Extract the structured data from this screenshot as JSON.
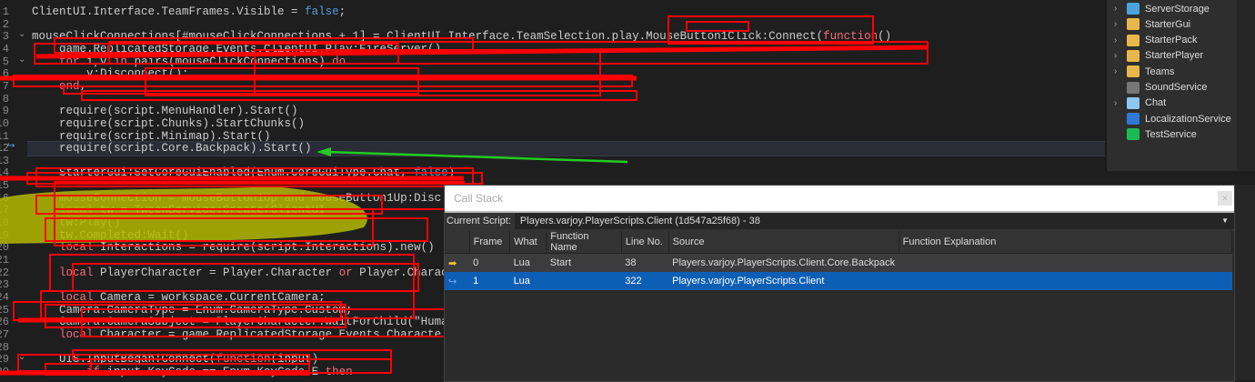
{
  "editor": {
    "lines": [
      {
        "n": "1",
        "segs": [
          [
            "ClientUI.Interface.TeamFrames.Visible = ",
            ""
          ],
          [
            "false",
            "bool"
          ],
          [
            ";",
            ""
          ]
        ]
      },
      {
        "n": "2",
        "segs": []
      },
      {
        "n": "3",
        "fold": true,
        "segs": [
          [
            "mouseClickConnections[#mouseClickConnections + 1] = ClientUI.Interface.TeamSelection.play.MouseButton1Click:Connect(",
            ""
          ],
          [
            "function",
            "kw"
          ],
          [
            "()",
            ""
          ]
        ]
      },
      {
        "n": "4",
        "segs": [
          [
            "    game.ReplicatedStorage.Events.ClientUI.Play:FireServer()",
            ""
          ]
        ]
      },
      {
        "n": "5",
        "fold": true,
        "segs": [
          [
            "    ",
            ""
          ],
          [
            "for",
            "kw"
          ],
          [
            " i,v ",
            ""
          ],
          [
            "in",
            "kw"
          ],
          [
            " pairs(mouseClickConnections) ",
            ""
          ],
          [
            "do",
            "kw"
          ]
        ]
      },
      {
        "n": "6",
        "segs": [
          [
            "        v:Disconnect();",
            ""
          ]
        ]
      },
      {
        "n": "7",
        "segs": [
          [
            "    ",
            ""
          ],
          [
            "end",
            "kw"
          ],
          [
            ",",
            ""
          ]
        ]
      },
      {
        "n": "8",
        "segs": []
      },
      {
        "n": "9",
        "segs": [
          [
            "    require(script.MenuHandler).Start()",
            ""
          ]
        ]
      },
      {
        "n": "10",
        "segs": [
          [
            "    require(script.Chunks).StartChunks()",
            ""
          ]
        ]
      },
      {
        "n": "11",
        "segs": [
          [
            "    require(script.Minimap).Start()",
            ""
          ]
        ]
      },
      {
        "n": "12",
        "current": true,
        "segs": [
          [
            "    require(script.Core.Backpack).Start()",
            ""
          ]
        ]
      },
      {
        "n": "13",
        "segs": []
      },
      {
        "n": "14",
        "segs": [
          [
            "    StarterGui:SetCoreGuiEnabled(Enum.CoreGuiType.Chat, ",
            ""
          ],
          [
            "false",
            "bool"
          ],
          [
            ")",
            ""
          ]
        ]
      },
      {
        "n": "15",
        "segs": []
      },
      {
        "n": "16",
        "segs": [
          [
            "    mouseConnection = mouseButton1Up and mouseButton1Up:Disc",
            ""
          ]
        ]
      },
      {
        "n": "17",
        "segs": [
          [
            "    ",
            ""
          ],
          [
            "local",
            "kw"
          ],
          [
            " tw = TweenService:Create(ClientUI",
            ""
          ]
        ]
      },
      {
        "n": "18",
        "segs": [
          [
            "    tw:Play()",
            ""
          ]
        ]
      },
      {
        "n": "19",
        "segs": [
          [
            "    tw.Completed:Wait()",
            ""
          ]
        ]
      },
      {
        "n": "20",
        "segs": [
          [
            "    ",
            ""
          ],
          [
            "local",
            "kw"
          ],
          [
            " Interactions = require(script.Interactions).new()",
            ""
          ]
        ]
      },
      {
        "n": "21",
        "segs": []
      },
      {
        "n": "22",
        "segs": [
          [
            "    ",
            ""
          ],
          [
            "local",
            "kw"
          ],
          [
            " PlayerCharacter = Player.Character ",
            ""
          ],
          [
            "or",
            "kw"
          ],
          [
            " Player.Characte",
            ""
          ]
        ]
      },
      {
        "n": "23",
        "segs": []
      },
      {
        "n": "24",
        "segs": [
          [
            "    ",
            ""
          ],
          [
            "local",
            "kw"
          ],
          [
            " Camera = workspace.CurrentCamera;",
            ""
          ]
        ]
      },
      {
        "n": "25",
        "segs": [
          [
            "    Camera.CameraType = Enum.CameraType.Custom;",
            ""
          ]
        ]
      },
      {
        "n": "26",
        "segs": [
          [
            "    Camera.CameraSubject = PlayerCharacter:WaitForChild(\"Humanoid\")",
            ""
          ]
        ]
      },
      {
        "n": "27",
        "segs": [
          [
            "    ",
            ""
          ],
          [
            "local",
            "kw"
          ],
          [
            " Character = game.ReplicatedStorage.Events.Characte",
            ""
          ]
        ]
      },
      {
        "n": "28",
        "segs": []
      },
      {
        "n": "29",
        "fold": true,
        "segs": [
          [
            "    UIS.InputBegan:Connect(",
            ""
          ],
          [
            "function",
            "kw"
          ],
          [
            "(input)",
            ""
          ]
        ]
      },
      {
        "n": "30",
        "fold": true,
        "segs": [
          [
            "        ",
            ""
          ],
          [
            "if",
            "kw"
          ],
          [
            " input.KeyCode == Enum.KeyCode.E ",
            ""
          ],
          [
            "then",
            "kw"
          ]
        ]
      }
    ]
  },
  "explorer": {
    "items": [
      {
        "label": "ServerStorage",
        "expandable": true,
        "color": "#4aa3df"
      },
      {
        "label": "StarterGui",
        "expandable": true,
        "color": "#e8b84a"
      },
      {
        "label": "StarterPack",
        "expandable": true,
        "color": "#e8b84a"
      },
      {
        "label": "StarterPlayer",
        "expandable": true,
        "color": "#e8b84a"
      },
      {
        "label": "Teams",
        "expandable": true,
        "color": "#e8b84a"
      },
      {
        "label": "SoundService",
        "expandable": false,
        "color": "#777777"
      },
      {
        "label": "Chat",
        "expandable": true,
        "color": "#8cc8f0"
      },
      {
        "label": "LocalizationService",
        "expandable": false,
        "color": "#2f79d6"
      },
      {
        "label": "TestService",
        "expandable": false,
        "color": "#1db954"
      }
    ]
  },
  "callstack": {
    "title": "Call Stack",
    "current_script_label": "Current Script:",
    "current_script_value": "Players.varjoy.PlayerScripts.Client (1d547a25f68) - 38",
    "columns": [
      "",
      "Frame",
      "What",
      "Function Name",
      "Line No.",
      "Source",
      "Function Explanation"
    ],
    "rows": [
      {
        "icon": "current-frame-arrow-icon",
        "frame": "0",
        "what": "Lua",
        "function": "Start",
        "line": "38",
        "source": "Players.varjoy.PlayerScripts.Client.Core.Backpack",
        "explanation": ""
      },
      {
        "icon": "caller-frame-arrow-icon",
        "frame": "1",
        "what": "Lua",
        "function": "",
        "line": "322",
        "source": "Players.varjoy.PlayerScripts.Client",
        "explanation": ""
      }
    ]
  },
  "colors": {
    "selection": "#0d5fb5",
    "annotation_red": "#ff0000",
    "annotation_green": "#22cc22",
    "highlight": "#b5b800"
  }
}
